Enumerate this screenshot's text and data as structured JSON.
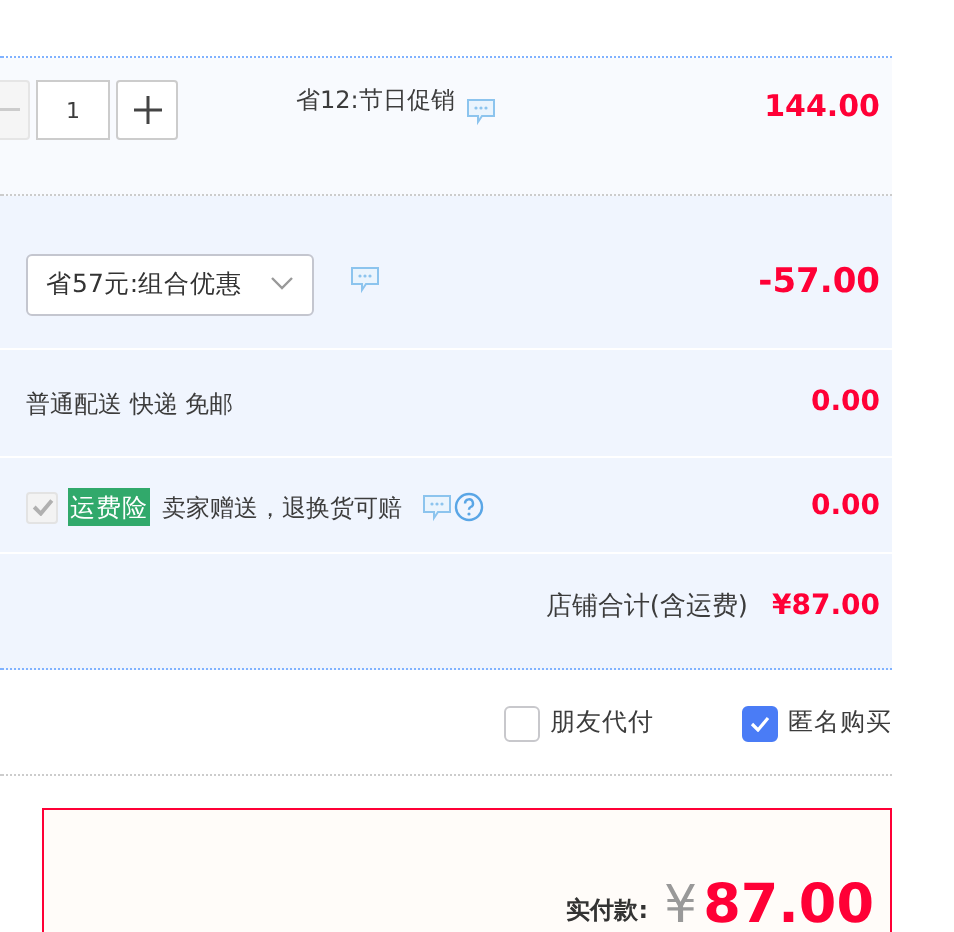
{
  "item": {
    "quantity": "1",
    "promotion": "省12:节日促销",
    "price": "144.00"
  },
  "promo": {
    "selected_option": "省57元:组合优惠",
    "amount": "-57.00"
  },
  "shipping": {
    "text": "普通配送 快递 免邮",
    "amount": "0.00"
  },
  "insurance": {
    "checked": true,
    "disabled": true,
    "badge": "运费险",
    "text": "卖家赠送，退换货可赔",
    "amount": "0.00"
  },
  "store_total": {
    "label": "店铺合计(含运费)",
    "amount": "¥87.00"
  },
  "options": [
    {
      "label": "朋友代付",
      "checked": false
    },
    {
      "label": "匿名购买",
      "checked": true
    }
  ],
  "payment": {
    "label": "实付款:",
    "currency": "¥",
    "amount": "87.00"
  }
}
